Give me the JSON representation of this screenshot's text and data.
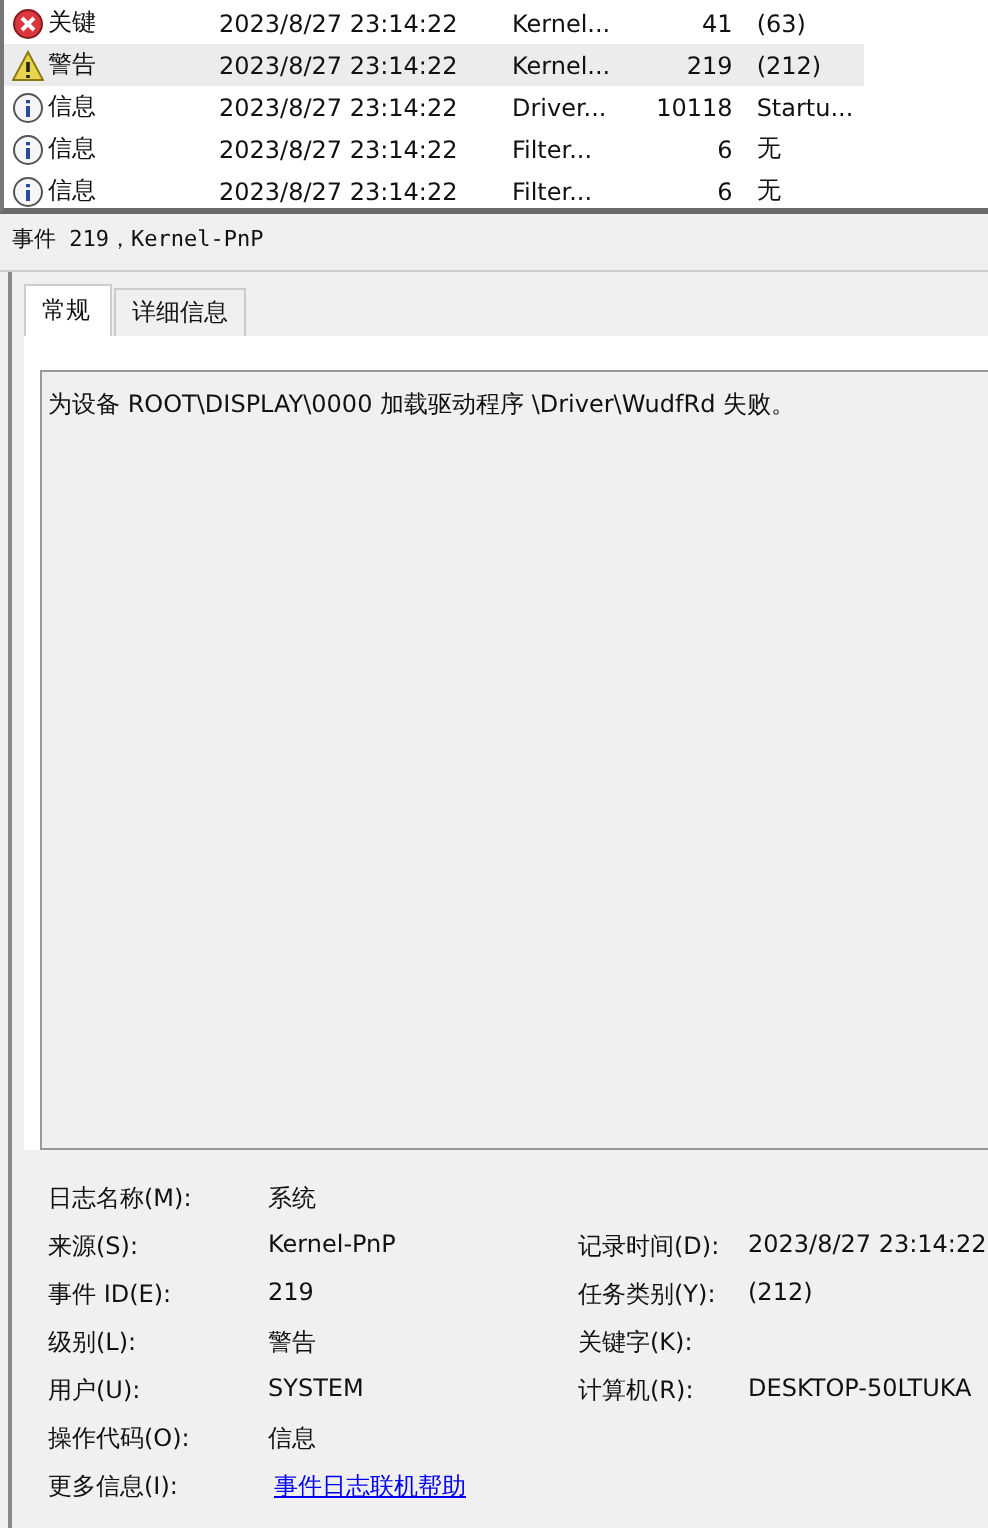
{
  "events": [
    {
      "level": "关键",
      "kind": "critical",
      "date": "2023/8/27 23:14:22",
      "source": "Kernel...",
      "id": "41",
      "task": "(63)",
      "selected": false
    },
    {
      "level": "警告",
      "kind": "warning",
      "date": "2023/8/27 23:14:22",
      "source": "Kernel...",
      "id": "219",
      "task": "(212)",
      "selected": true
    },
    {
      "level": "信息",
      "kind": "info",
      "date": "2023/8/27 23:14:22",
      "source": "Driver...",
      "id": "10118",
      "task": "Startu...",
      "selected": false
    },
    {
      "level": "信息",
      "kind": "info",
      "date": "2023/8/27 23:14:22",
      "source": "Filter...",
      "id": "6",
      "task": "无",
      "selected": false
    },
    {
      "level": "信息",
      "kind": "info",
      "date": "2023/8/27 23:14:22",
      "source": "Filter...",
      "id": "6",
      "task": "无",
      "selected": false
    }
  ],
  "detail": {
    "title": "事件 219，Kernel-PnP",
    "tabs": [
      {
        "label": "常规",
        "selected": true
      },
      {
        "label": "详细信息",
        "selected": false
      }
    ],
    "description": "为设备 ROOT\\DISPLAY\\0000 加载驱动程序 \\Driver\\WudfRd 失败。",
    "fields": [
      {
        "label": "日志名称(M):",
        "value": "系统"
      },
      {
        "label": "来源(S):",
        "value": "Kernel-PnP",
        "label2": "记录时间(D):",
        "value2": "2023/8/27 23:14:22"
      },
      {
        "label": "事件 ID(E):",
        "value": "219",
        "label2": "任务类别(Y):",
        "value2": "(212)"
      },
      {
        "label": "级别(L):",
        "value": "警告",
        "label2": "关键字(K):"
      },
      {
        "label": "用户(U):",
        "value": "SYSTEM",
        "label2": "计算机(R):",
        "value2": "DESKTOP-50LTUKA"
      },
      {
        "label": "操作代码(O):",
        "value": "信息"
      },
      {
        "label": "更多信息(I):",
        "link": "事件日志联机帮助"
      }
    ]
  }
}
